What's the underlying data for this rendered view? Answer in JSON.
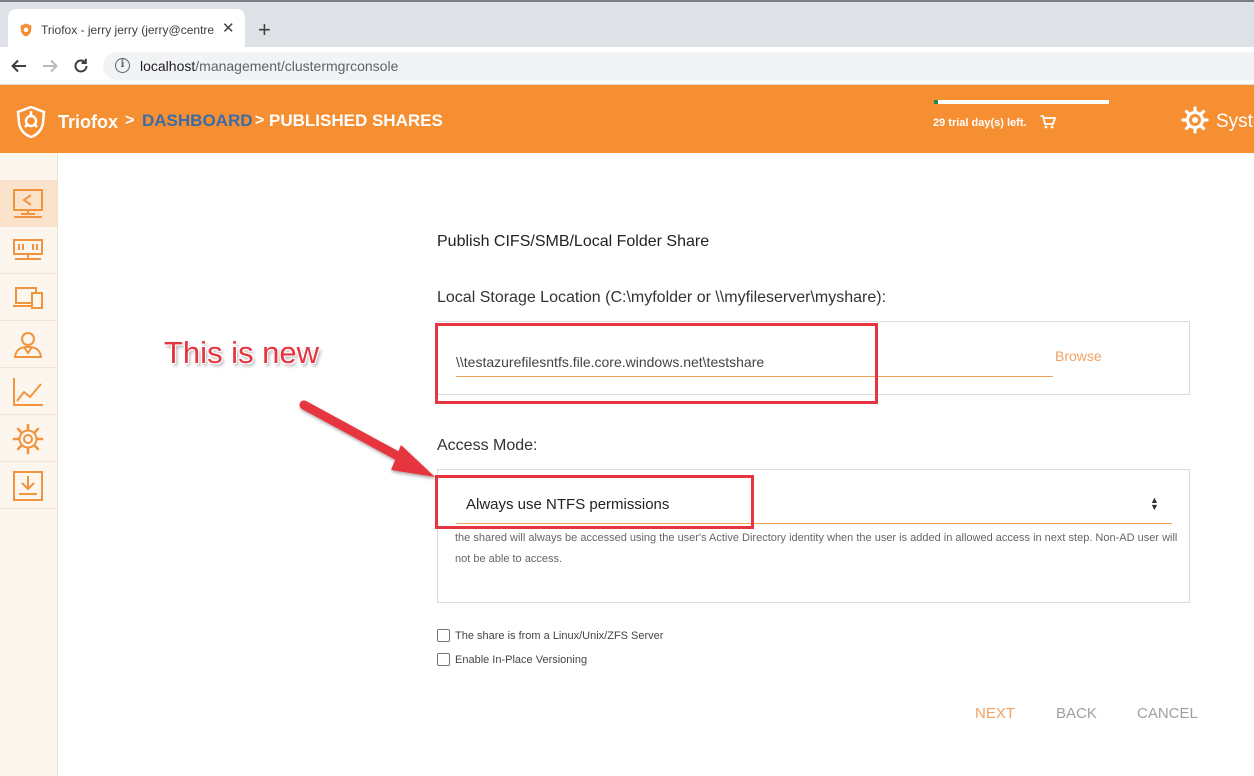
{
  "browser": {
    "tab_title": "Triofox - jerry jerry (jerry@centre",
    "tab_close": "✕",
    "new_tab": "+",
    "url_host": "localhost",
    "url_path": "/management/clustermgrconsole"
  },
  "header": {
    "brand": "Triofox",
    "crumb_sep": ">",
    "crumb_dashboard": "DASHBOARD",
    "crumb_current": "PUBLISHED SHARES",
    "trial_text": "29 trial day(s) left.",
    "trial_progress_fraction": 0.02,
    "system_label": "Syste",
    "accent_color": "#f58f32",
    "dashboard_color": "#3a6ca8"
  },
  "sidebar": {
    "items": [
      {
        "icon": "share-screen-icon",
        "active": true
      },
      {
        "icon": "server-icon",
        "active": false
      },
      {
        "icon": "devices-icon",
        "active": false
      },
      {
        "icon": "users-icon",
        "active": false
      },
      {
        "icon": "chart-icon",
        "active": false
      },
      {
        "icon": "gear-icon",
        "active": false
      },
      {
        "icon": "download-icon",
        "active": false
      }
    ]
  },
  "form": {
    "title": "Publish CIFS/SMB/Local Folder Share",
    "storage_label": "Local Storage Location (C:\\myfolder or \\\\myfileserver\\myshare):",
    "storage_value": "\\\\testazurefilesntfs.file.core.windows.net\\testshare",
    "browse_label": "Browse",
    "access_label": "Access Mode:",
    "access_value": "Always use NTFS permissions",
    "access_help": "the shared will always be accessed using the user's Active Directory identity when the user is added in allowed access in next step. Non-AD user will not be able to access.",
    "checkbox_linux": "The share is from a Linux/Unix/ZFS Server",
    "checkbox_versioning": "Enable In-Place Versioning",
    "next_label": "NEXT",
    "back_label": "BACK",
    "cancel_label": "CANCEL"
  },
  "annotation": {
    "text": "This is new",
    "color": "#e7353f"
  }
}
